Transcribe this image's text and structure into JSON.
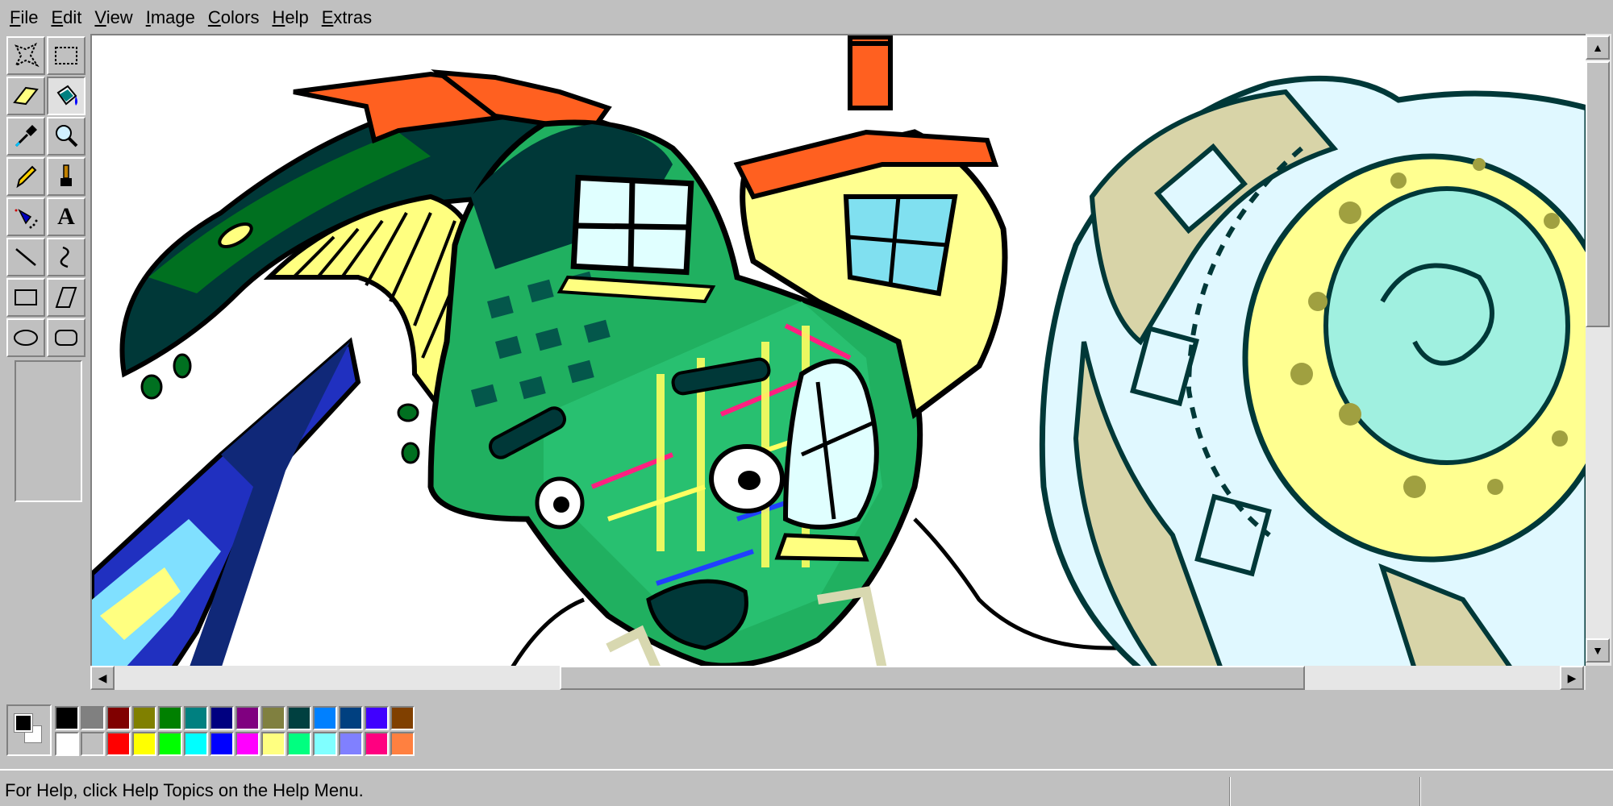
{
  "menu": {
    "file": {
      "u": "F",
      "rest": "ile"
    },
    "edit": {
      "u": "E",
      "rest": "dit"
    },
    "view": {
      "u": "V",
      "rest": "iew"
    },
    "image": {
      "u": "I",
      "rest": "mage"
    },
    "colors": {
      "u": "C",
      "rest": "olors"
    },
    "help": {
      "u": "H",
      "rest": "elp"
    },
    "extras": {
      "u": "E",
      "rest": "xtras"
    }
  },
  "tools": [
    {
      "name": "free-form-select",
      "icon": "free-form-select-icon"
    },
    {
      "name": "rectangle-select",
      "icon": "rectangle-select-icon"
    },
    {
      "name": "eraser",
      "icon": "eraser-icon"
    },
    {
      "name": "fill-with-color",
      "icon": "paint-bucket-icon",
      "active": true
    },
    {
      "name": "pick-color",
      "icon": "eyedropper-icon"
    },
    {
      "name": "magnifier",
      "icon": "magnifier-icon"
    },
    {
      "name": "pencil",
      "icon": "pencil-icon"
    },
    {
      "name": "brush",
      "icon": "brush-icon"
    },
    {
      "name": "airbrush",
      "icon": "airbrush-icon"
    },
    {
      "name": "text",
      "icon": "text-icon",
      "glyph": "A"
    },
    {
      "name": "line",
      "icon": "line-icon"
    },
    {
      "name": "curve",
      "icon": "curve-icon"
    },
    {
      "name": "rectangle",
      "icon": "rectangle-icon"
    },
    {
      "name": "polygon",
      "icon": "polygon-icon"
    },
    {
      "name": "ellipse",
      "icon": "ellipse-icon"
    },
    {
      "name": "rounded-rectangle",
      "icon": "rounded-rectangle-icon"
    }
  ],
  "palette": {
    "foreground": "#000000",
    "background": "#ffffff",
    "top": [
      "#000000",
      "#808080",
      "#800000",
      "#808000",
      "#008000",
      "#008080",
      "#000080",
      "#800080",
      "#808040",
      "#004040",
      "#0080ff",
      "#004080",
      "#4000ff",
      "#804000"
    ],
    "bottom": [
      "#ffffff",
      "#c0c0c0",
      "#ff0000",
      "#ffff00",
      "#00ff00",
      "#00ffff",
      "#0000ff",
      "#ff00ff",
      "#ffff80",
      "#00ff80",
      "#80ffff",
      "#8080ff",
      "#ff0080",
      "#ff8040"
    ]
  },
  "status": {
    "text": "For Help, click Help Topics on the Help Menu."
  }
}
